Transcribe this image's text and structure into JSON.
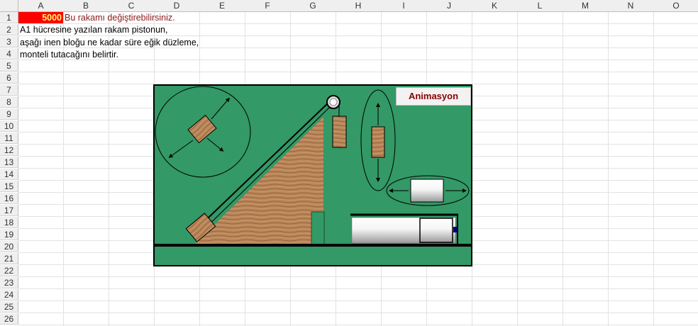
{
  "sheet": {
    "columns": [
      "A",
      "B",
      "C",
      "D",
      "E",
      "F",
      "G",
      "H",
      "I",
      "J",
      "K",
      "L",
      "M",
      "N",
      "O"
    ],
    "rows": [
      "1",
      "2",
      "3",
      "4",
      "5",
      "6",
      "7",
      "8",
      "9",
      "10",
      "11",
      "12",
      "13",
      "14",
      "15",
      "16",
      "17",
      "18",
      "19",
      "20",
      "21",
      "22",
      "23",
      "24",
      "25",
      "26"
    ]
  },
  "cells": {
    "a1_value": "5000",
    "b1_note": "Bu rakamı değiştirebilirsiniz.",
    "a2_text": "A1 hücresine yazılan rakam pistonun,",
    "a3_text": "aşağı inen bloğu ne kadar süre eğik düzleme,",
    "a4_text": "monteli tutacağını belirtir."
  },
  "scene": {
    "button_label": "Animasyon",
    "colors": {
      "background": "#339966",
      "wood": "#b9865a",
      "block": "#a8693a",
      "note_red": "#8b1a1a",
      "a1_fill": "#ff0000",
      "a1_text": "#ffff66"
    }
  }
}
